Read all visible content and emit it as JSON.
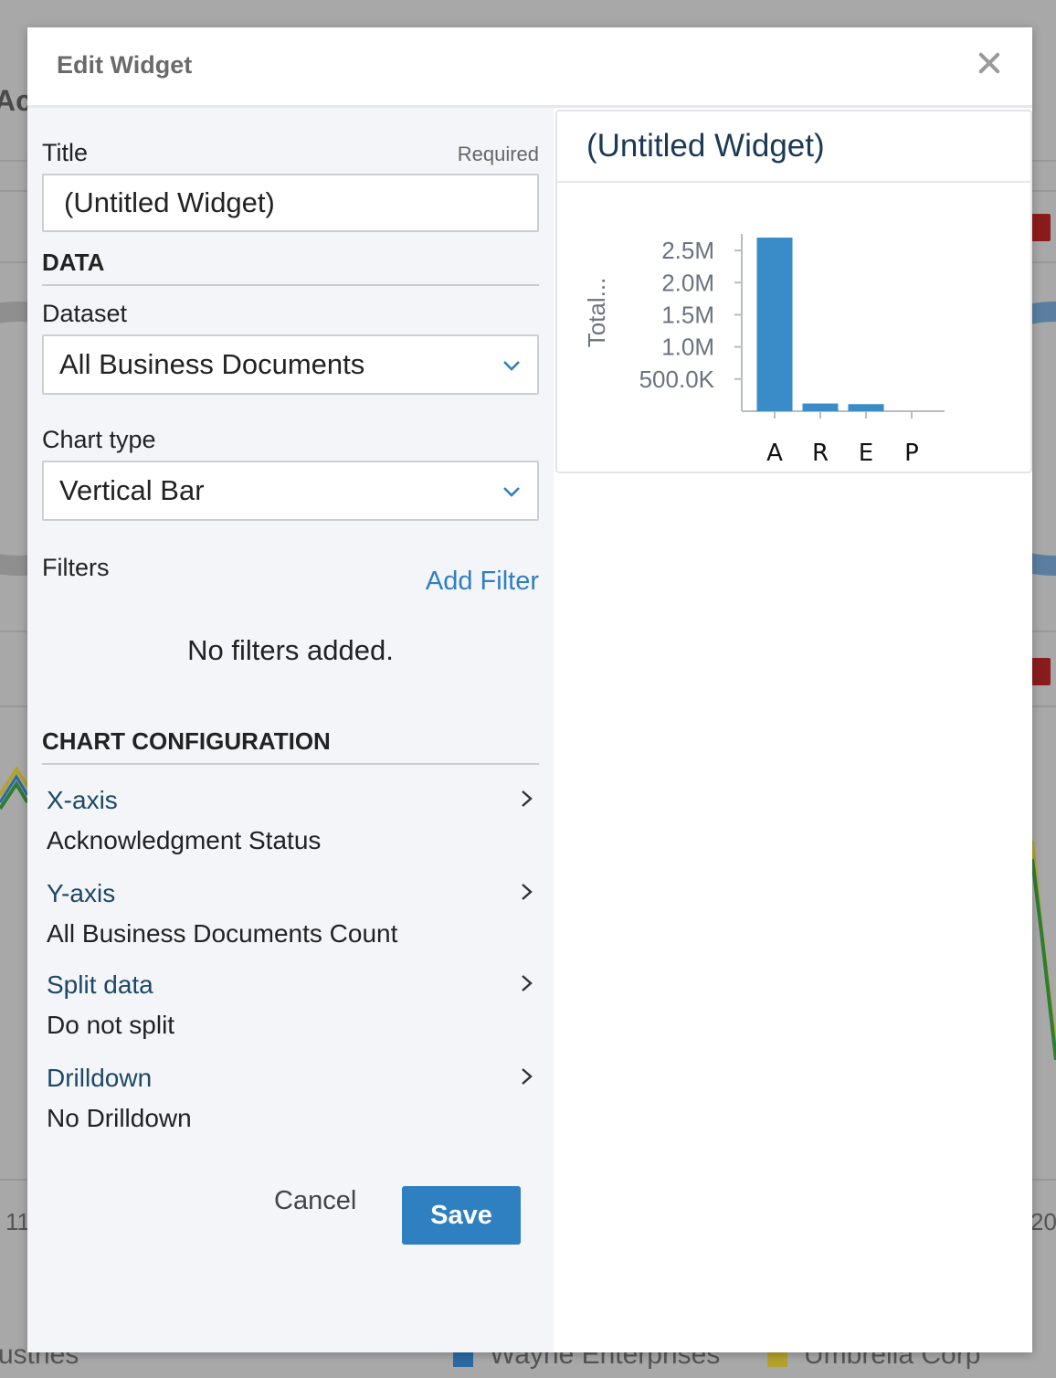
{
  "background": {
    "heading_fragment": "Ac",
    "tick_left": "11",
    "tick_right": "20",
    "legend_left": "ustries",
    "legend_items": [
      {
        "label": "Wayne Enterprises",
        "color": "#2a6aa3"
      },
      {
        "label": "Umbrella Corp",
        "color": "#b3a22b"
      }
    ]
  },
  "modal": {
    "title": "Edit Widget",
    "close_icon": "close-icon"
  },
  "form": {
    "title_label": "Title",
    "title_required": "Required",
    "title_value": "(Untitled Widget)",
    "data_section": "DATA",
    "dataset_label": "Dataset",
    "dataset_value": "All Business Documents",
    "chart_type_label": "Chart type",
    "chart_type_value": "Vertical Bar",
    "filters_label": "Filters",
    "add_filter": "Add Filter",
    "no_filters": "No filters added.",
    "config_section": "CHART CONFIGURATION",
    "config_items": [
      {
        "label": "X-axis",
        "value": "Acknowledgment Status"
      },
      {
        "label": "Y-axis",
        "value": "All Business Documents Count"
      },
      {
        "label": "Split data",
        "value": "Do not split"
      },
      {
        "label": "Drilldown",
        "value": "No Drilldown"
      }
    ],
    "cancel": "Cancel",
    "save": "Save"
  },
  "preview": {
    "title": "(Untitled Widget)"
  },
  "chart_data": {
    "type": "bar",
    "categories": [
      "A",
      "R",
      "E",
      "P"
    ],
    "values": [
      2700000,
      120000,
      110000,
      0
    ],
    "ylabel": "Total...",
    "yticks": [
      500000,
      1000000,
      1500000,
      2000000,
      2500000
    ],
    "ytick_labels": [
      "500.0K",
      "1.0M",
      "1.5M",
      "2.0M",
      "2.5M"
    ],
    "ylim": [
      0,
      2700000
    ],
    "bar_color": "#3a8cc8",
    "grid": false
  }
}
